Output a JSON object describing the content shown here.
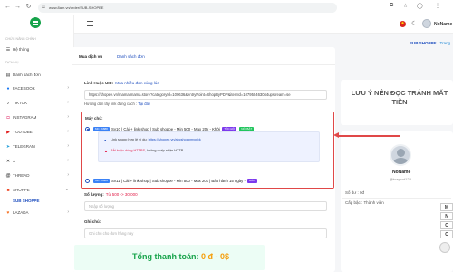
{
  "browser": {
    "url": "www.8am.vn/order/SUB-SHOPEE"
  },
  "sidebar": {
    "section_main": "CHỨC NĂNG CHÍNH",
    "home": "Hệ thống",
    "section_service": "DỊCH VỤ",
    "orders": "Danh sách đơn",
    "items": [
      {
        "label": "FACEBOOK",
        "icon": "facebook-icon"
      },
      {
        "label": "TIKTOK",
        "icon": "tiktok-icon"
      },
      {
        "label": "INSTAGRAM",
        "icon": "instagram-icon"
      },
      {
        "label": "YOUTUBE",
        "icon": "youtube-icon"
      },
      {
        "label": "TELEGRAM",
        "icon": "telegram-icon"
      },
      {
        "label": "X",
        "icon": "x-icon"
      },
      {
        "label": "THREAD",
        "icon": "thread-icon"
      },
      {
        "label": "SHOPPE",
        "icon": "shopee-icon"
      },
      {
        "label": "LAZADA",
        "icon": "lazada-icon"
      }
    ],
    "sub_active": "SUB SHOPPE"
  },
  "header": {
    "username": "NoName"
  },
  "breadcrumb": {
    "current": "SUB SHOPPE",
    "next": "Trang"
  },
  "tabs": [
    {
      "label": "Mua dịch vụ",
      "active": true
    },
    {
      "label": "Danh sách đơn",
      "active": false
    }
  ],
  "form": {
    "link_label": "Link Huộc UID:",
    "link_help": "Mua nhiều đơn cùng lúc",
    "link_value": "https://shopee.vn/mama.mama.store?categoryId=100636&entryPoint=ShopByPDP&itemId=107950463044upstream=se",
    "guide_text": "Hướng dẫn lấy link đúng cách :",
    "guide_link": "Tại đây",
    "server_label": "Máy chủ:",
    "servers": [
      {
        "badge": "MC 16888",
        "text": "Sv10 | Cài + link shop | Sub shoppe - Min 500 - Max 20k - Khởi",
        "tags": [
          "TỐC ĐỘ",
          "NỔI BẬT"
        ],
        "selected": true
      },
      {
        "badge": "MC 16889",
        "text": "Sv11 | Cài + link shop | Sub shoppe - Min 500 - Max 20k | Bảo hành 15 ngày -",
        "tags": [
          "BẢO"
        ],
        "selected": false
      }
    ],
    "notes": [
      {
        "prefix": "Link shopp hợp lệ ví dụ:",
        "link": "https://shopee.vn/abcshoppmypick"
      },
      {
        "prefix": "Bắt buộc dùng HTTPS,",
        "suffix": "không chấp nhận HTTP."
      }
    ],
    "qty_label": "Số lượng:",
    "qty_range": "Từ 500 -> 30,000",
    "qty_placeholder": "Nhập số lượng",
    "note_label": "Ghi chú:",
    "note_placeholder": "Ghi chú cho đơn hàng này",
    "total_label": "Tổng thanh toán:",
    "total_value": "0 đ - 0$"
  },
  "right_panel": {
    "notice": "LƯU Ý NÊN ĐỌC TRÁNH MẤT TIỀN",
    "profile_name": "NoName",
    "profile_handle": "@toapcut123",
    "balance_label": "Số dư :",
    "balance_value": "0đ",
    "rank_label": "Cấp bậc :",
    "rank_value": "Thành viên",
    "side_tags": [
      "M",
      "N",
      "C",
      "C"
    ]
  },
  "colors": {
    "accent": "#1f4fbf",
    "highlight_red": "#e04848",
    "success_green": "#16a34a",
    "warning_amber": "#f59e0b"
  }
}
